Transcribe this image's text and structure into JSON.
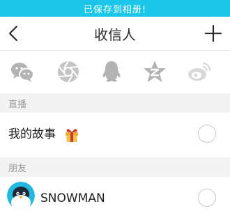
{
  "toast": {
    "text": "已保存到相册!",
    "color": "#1cc6e8"
  },
  "nav": {
    "title": "收信人",
    "back_icon": "chevron-left-icon",
    "add_icon": "plus-icon"
  },
  "share": {
    "items": [
      {
        "name": "wechat-icon"
      },
      {
        "name": "moments-icon"
      },
      {
        "name": "qq-icon"
      },
      {
        "name": "qzone-icon"
      },
      {
        "name": "weibo-icon"
      }
    ]
  },
  "sections": {
    "live": {
      "header": "直播"
    },
    "friends": {
      "header": "朋友"
    }
  },
  "rows": {
    "my_story": {
      "label": "我的故事",
      "icon": "gift-icon"
    },
    "snowman": {
      "name": "SNOWMAN",
      "icon": "avatar-icon"
    }
  }
}
